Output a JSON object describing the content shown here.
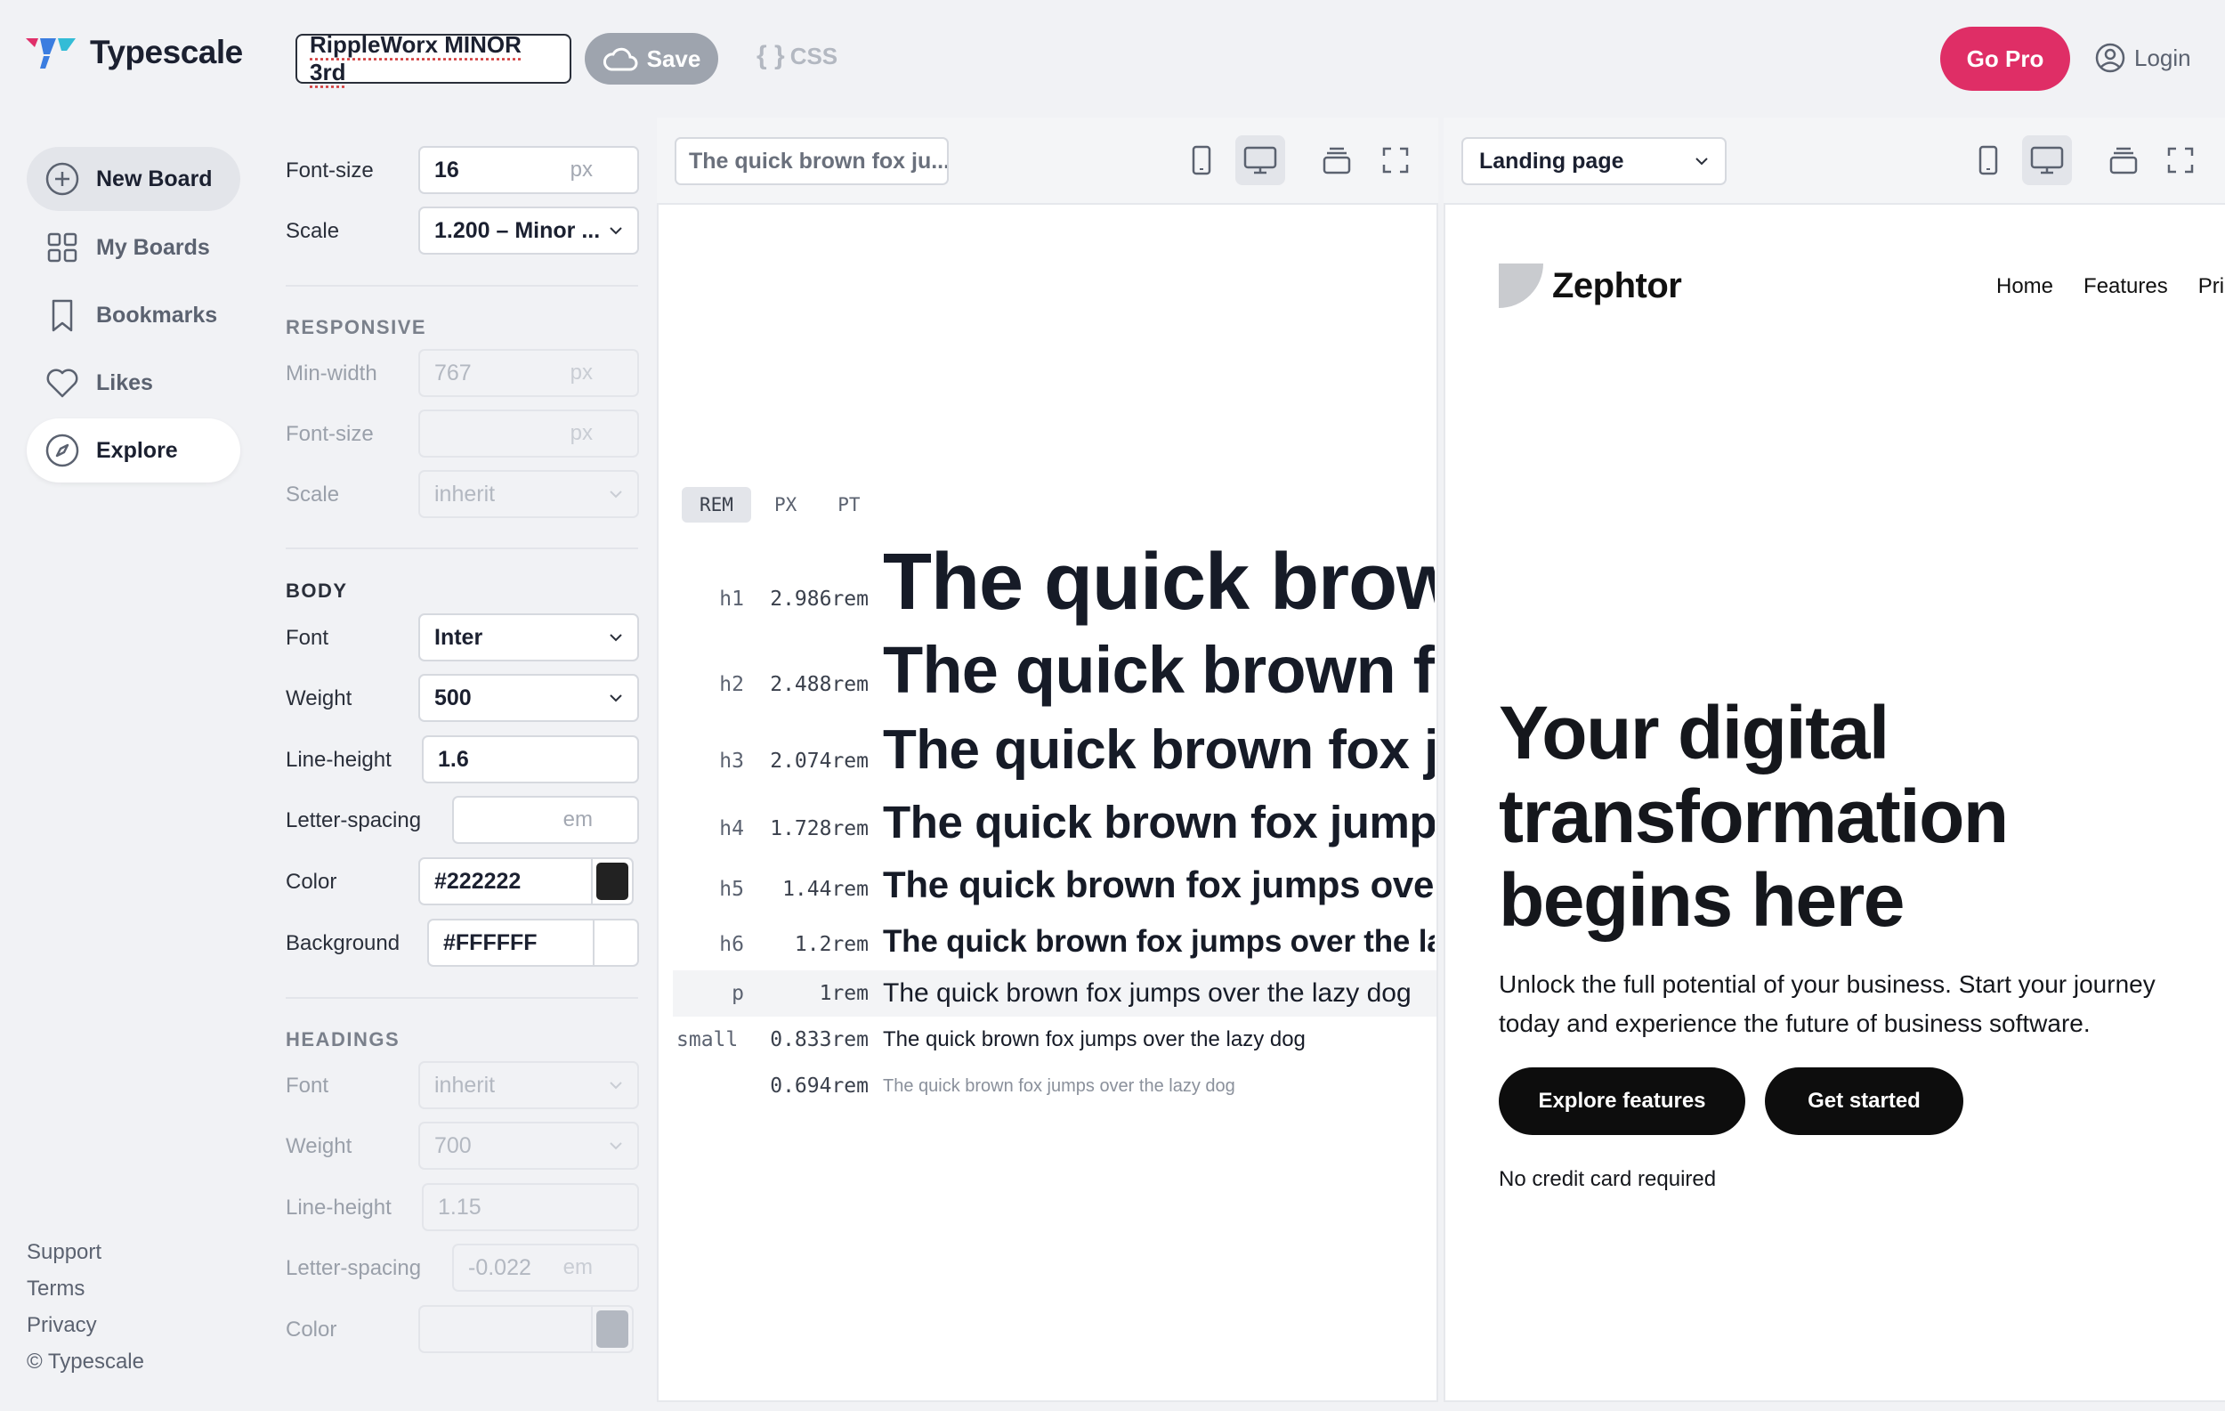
{
  "app": {
    "name": "Typescale",
    "board_name": "RippleWorx MINOR 3rd",
    "save_label": "Save",
    "css_label": "CSS",
    "gopro_label": "Go Pro",
    "login_label": "Login",
    "brand_colors": [
      "#e0306a",
      "#3b7de0",
      "#33bcd6"
    ]
  },
  "nav": {
    "items": [
      {
        "label": "New Board",
        "icon": "plus-circle-icon"
      },
      {
        "label": "My Boards",
        "icon": "grid-icon"
      },
      {
        "label": "Bookmarks",
        "icon": "bookmark-icon"
      },
      {
        "label": "Likes",
        "icon": "heart-icon"
      },
      {
        "label": "Explore",
        "icon": "compass-icon"
      }
    ],
    "footer": [
      "Support",
      "Terms",
      "Privacy",
      "© Typescale"
    ]
  },
  "settings": {
    "font_size": {
      "label": "Font-size",
      "value": "16",
      "unit": "px"
    },
    "scale": {
      "label": "Scale",
      "value": "1.200 – Minor ..."
    },
    "responsive": {
      "title": "RESPONSIVE",
      "min_width": {
        "label": "Min-width",
        "placeholder": "767",
        "unit": "px"
      },
      "font_size": {
        "label": "Font-size",
        "unit": "px"
      },
      "scale": {
        "label": "Scale",
        "value": "inherit"
      }
    },
    "body": {
      "title": "BODY",
      "font": {
        "label": "Font",
        "value": "Inter"
      },
      "weight": {
        "label": "Weight",
        "value": "500"
      },
      "line_height": {
        "label": "Line-height",
        "value": "1.6"
      },
      "letter_spacing": {
        "label": "Letter-spacing",
        "unit": "em"
      },
      "color": {
        "label": "Color",
        "value": "#222222"
      },
      "background": {
        "label": "Background",
        "value": "#FFFFFF"
      }
    },
    "headings": {
      "title": "HEADINGS",
      "font": {
        "label": "Font",
        "value": "inherit"
      },
      "weight": {
        "label": "Weight",
        "value": "700"
      },
      "line_height": {
        "label": "Line-height",
        "value": "1.15"
      },
      "letter_spacing": {
        "label": "Letter-spacing",
        "value": "-0.022",
        "unit": "em"
      },
      "color": {
        "label": "Color"
      }
    }
  },
  "preview": {
    "sample_input": "The quick brown fox ju...",
    "unit_tabs": [
      "REM",
      "PX",
      "PT"
    ],
    "active_unit": "REM",
    "rows": [
      {
        "tag": "h1",
        "size": "2.986rem",
        "text": "The quick brown fox jumps over the lazy dog"
      },
      {
        "tag": "h2",
        "size": "2.488rem",
        "text": "The quick brown fox jumps over the lazy dog"
      },
      {
        "tag": "h3",
        "size": "2.074rem",
        "text": "The quick brown fox jumps over the lazy dog"
      },
      {
        "tag": "h4",
        "size": "1.728rem",
        "text": "The quick brown fox jumps over the lazy dog"
      },
      {
        "tag": "h5",
        "size": "1.44rem",
        "text": "The quick brown fox jumps over the lazy dog"
      },
      {
        "tag": "h6",
        "size": "1.2rem",
        "text": "The quick brown fox jumps over the lazy dog"
      },
      {
        "tag": "p",
        "size": "1rem",
        "text": "The quick brown fox jumps over the lazy dog"
      },
      {
        "tag": "small",
        "size": "0.833rem",
        "text": "The quick brown fox jumps over the lazy dog"
      },
      {
        "tag": "",
        "size": "0.694rem",
        "text": "The quick brown fox jumps over the lazy dog"
      }
    ]
  },
  "landing": {
    "template": "Landing page",
    "brand": "Zephtor",
    "menu": [
      "Home",
      "Features",
      "Pric"
    ],
    "hero_title": "Your digital transformation begins here",
    "hero_sub": "Unlock the full potential of your business. Start your journey today and experience the future of business software.",
    "btn_primary": "Explore features",
    "btn_secondary": "Get started",
    "note": "No credit card required"
  }
}
